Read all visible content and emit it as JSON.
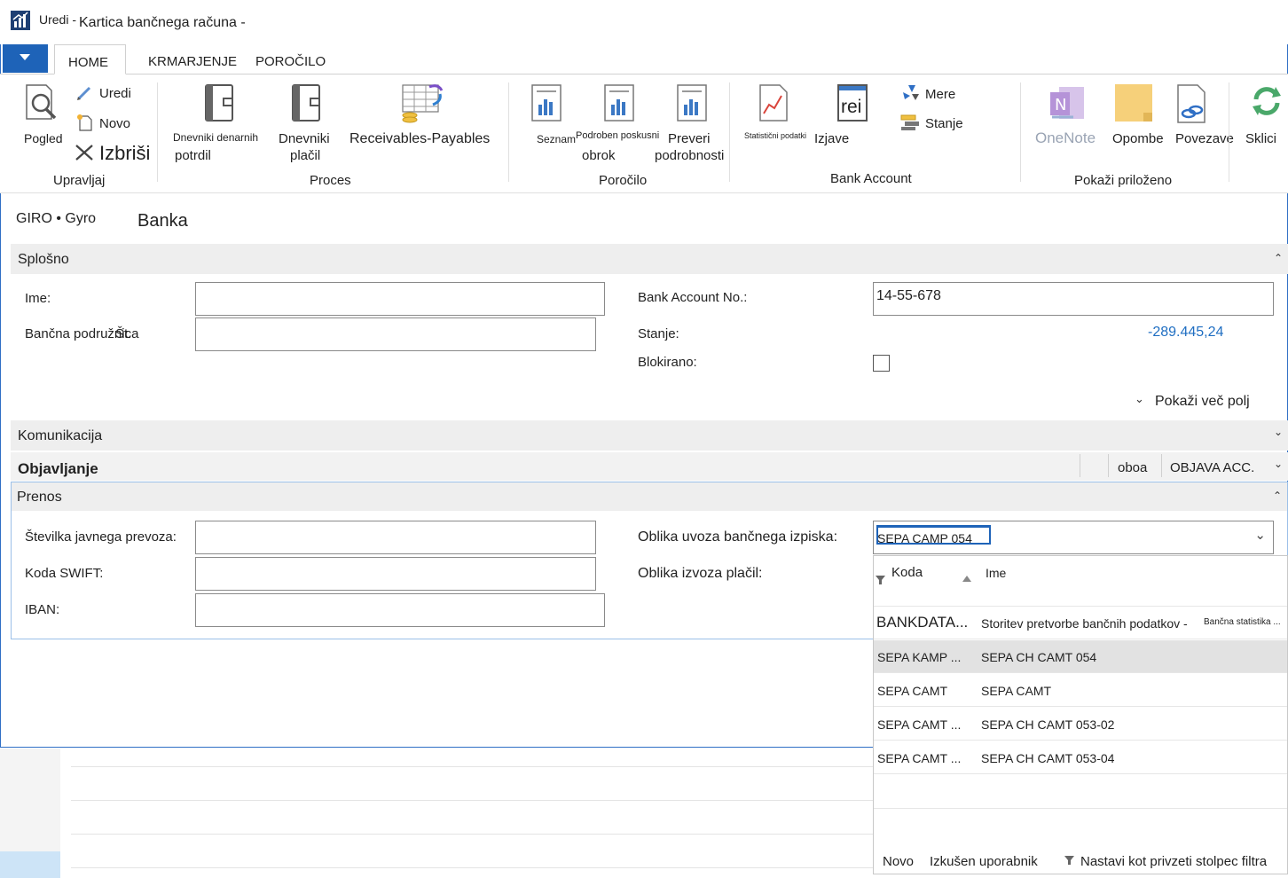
{
  "window": {
    "edit_label": "Uredi -",
    "title": "Kartica bančnega računa -"
  },
  "tabs": {
    "home": "HOME",
    "navigate": "KRMARJENJE",
    "report": "POROČILO"
  },
  "ribbon": {
    "manage": {
      "view": "Pogled",
      "edit": "Uredi",
      "new": "Novo",
      "delete": "Izbriši",
      "group": "Upravljaj"
    },
    "process": {
      "cash_receipt_line1": "Dnevniki denarnih",
      "cash_receipt_line2": "potrdil",
      "payment_line1": "Dnevniki",
      "payment_line2": "plačil",
      "receivables_payables": "Receivables-Payables",
      "group": "Proces"
    },
    "report": {
      "list": "Seznam",
      "detail_trial_line1": "Podroben poskusni",
      "detail_trial_line2": "obrok",
      "check_details_line1": "Preveri",
      "check_details_line2": "podrobnosti",
      "group": "Poročilo"
    },
    "bank_account": {
      "statistics": "Statistični podatki",
      "statements": "Izjave",
      "statements_icon_text": "rei",
      "dimensions": "Mere",
      "balance": "Stanje",
      "group": "Bank Account"
    },
    "show_attached": {
      "onenote": "OneNote",
      "notes": "Opombe",
      "links": "Povezave",
      "group": "Pokaži priloženo"
    },
    "refresh": "Sklici"
  },
  "header": {
    "breadcrumb": "GIRO • Gyro",
    "page_title": "Banka"
  },
  "general": {
    "title": "Splošno",
    "name_label": "Ime:",
    "name_value": "",
    "branch_label": "Bančna podružnica",
    "branch_overlay": "Št.",
    "branch_value": "",
    "bank_account_no_label": "Bank Account No.:",
    "bank_account_no_value": "14-55-678",
    "balance_label": "Stanje:",
    "balance_value": "-289.445,24",
    "blocked_label": "Blokirano:",
    "blocked": false,
    "show_more": "Pokaži več polj"
  },
  "communication": {
    "title": "Komunikacija"
  },
  "posting": {
    "title": "Objavljanje",
    "col1": "oboa",
    "col2": "OBJAVA ACC."
  },
  "transfer": {
    "title": "Prenos",
    "transit_no_label": "Številka javnega prevoza:",
    "swift_label": "Koda SWIFT:",
    "iban_label": "IBAN:",
    "import_format_label": "Oblika uvoza bančnega izpiska:",
    "import_format_value": "SEPA CAMP 054",
    "export_format_label": "Oblika izvoza plačil:"
  },
  "dropdown": {
    "col_code": "Koda",
    "col_name": "Ime",
    "rows": [
      {
        "code": "BANKDATA...",
        "name": "Storitev pretvorbe bančnih podatkov -",
        "extra": "Bančna statistika ..."
      },
      {
        "code": "SEPA KAMP ...",
        "name": "SEPA CH CAMT 054",
        "extra": ""
      },
      {
        "code": "SEPA CAMT",
        "name": "SEPA CAMT",
        "extra": ""
      },
      {
        "code": "SEPA CAMT ...",
        "name": "SEPA CH CAMT 053-02",
        "extra": ""
      },
      {
        "code": "SEPA CAMT ...",
        "name": "SEPA CH CAMT 053-04",
        "extra": ""
      }
    ],
    "footer_new": "Novo",
    "footer_advanced": "Izkušen uporabnik",
    "footer_filter": "Nastavi kot privzeti stolpec filtra"
  },
  "colors": {
    "accent": "#1e63b8",
    "link_blue": "#1f6ec2",
    "section_bg": "#eeeeee",
    "selected_row": "#e2e2e2"
  }
}
